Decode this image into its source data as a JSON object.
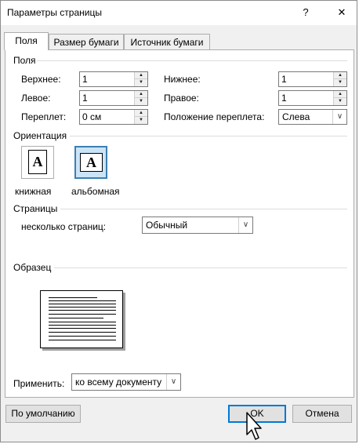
{
  "window": {
    "title": "Параметры страницы",
    "help": "?",
    "close": "✕"
  },
  "tabs": [
    {
      "label": "Поля"
    },
    {
      "label": "Размер бумаги"
    },
    {
      "label": "Источник бумаги"
    }
  ],
  "fields_group": {
    "label": "Поля",
    "top_label": "Верхнее:",
    "top_value": "1",
    "left_label": "Левое:",
    "left_value": "1",
    "gutter_label": "Переплет:",
    "gutter_value": "0 см",
    "bottom_label": "Нижнее:",
    "bottom_value": "1",
    "right_label": "Правое:",
    "right_value": "1",
    "gutter_pos_label": "Положение переплета:",
    "gutter_pos_value": "Слева"
  },
  "orientation": {
    "label": "Ориентация",
    "portrait": "книжная",
    "landscape": "альбомная",
    "glyph": "A"
  },
  "pages": {
    "label": "Страницы",
    "multiple_label": "несколько страниц:",
    "multiple_value": "Обычный"
  },
  "sample": {
    "label": "Образец"
  },
  "apply": {
    "label": "Применить:",
    "value": "ко всему документу"
  },
  "buttons": {
    "default": "По умолчанию",
    "ok": "OK",
    "cancel": "Отмена"
  }
}
